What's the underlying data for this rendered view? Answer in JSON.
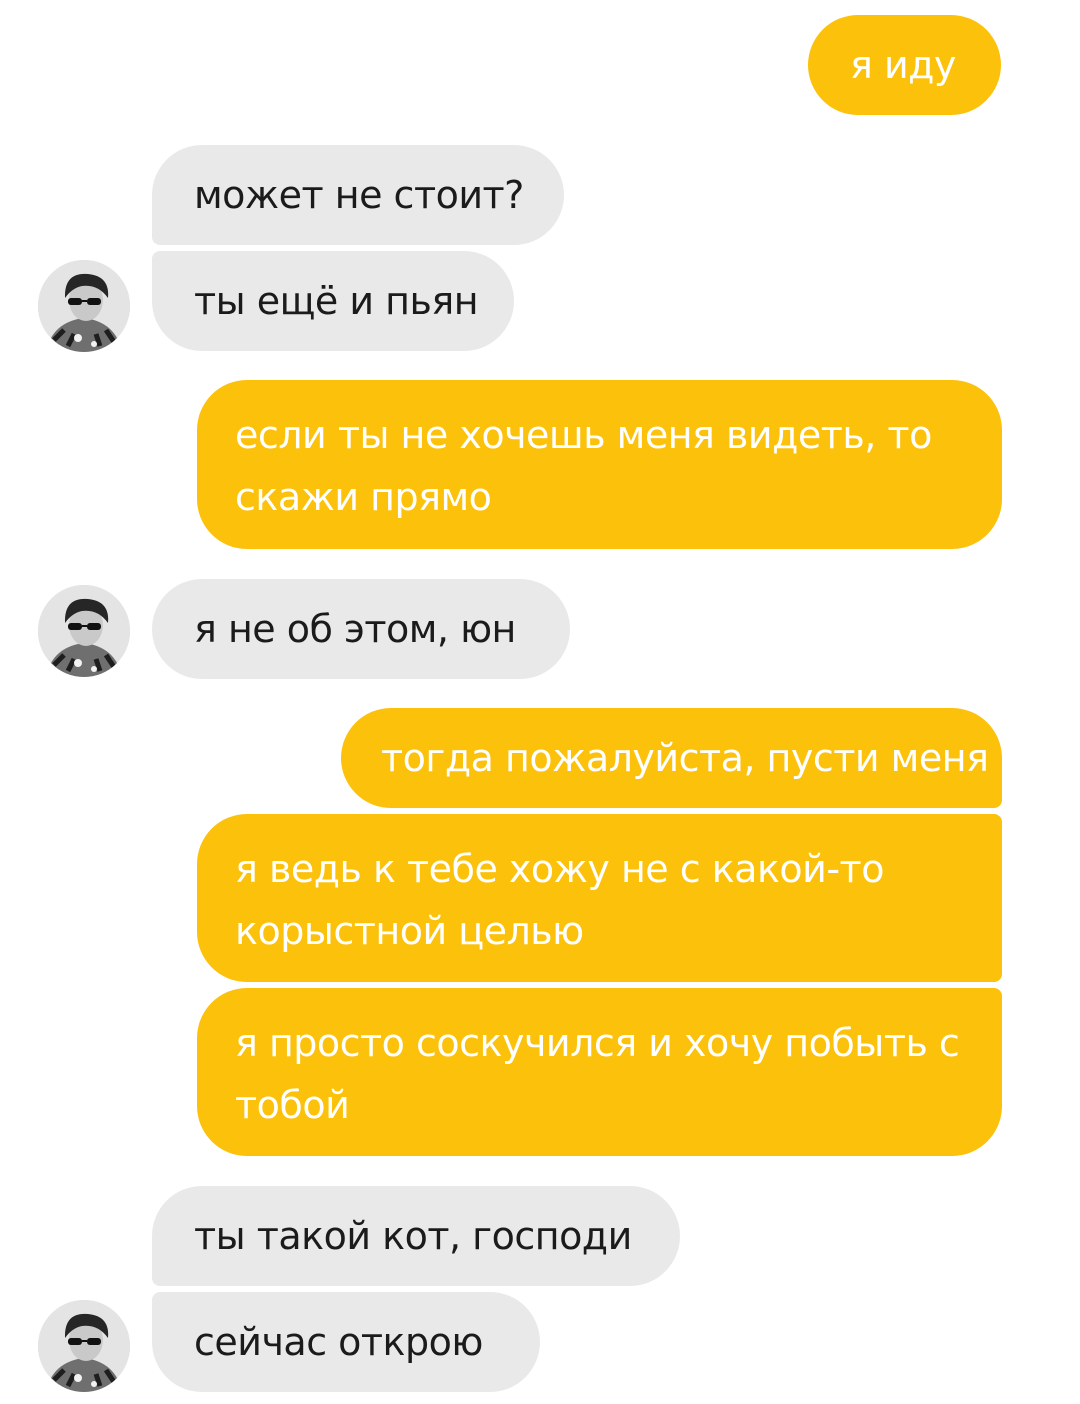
{
  "theme": {
    "outgoing_bubble_color": "#fcc10a",
    "incoming_bubble_color": "#e9e9e9",
    "outgoing_text_color": "#ffffff",
    "incoming_text_color": "#1b1b1b"
  },
  "messages": [
    {
      "sender": "me",
      "text": "я иду"
    },
    {
      "sender": "contact",
      "text": "может не стоит?"
    },
    {
      "sender": "contact",
      "text": "ты ещё и пьян"
    },
    {
      "sender": "me",
      "text": "если ты не хочешь меня видеть, то скажи прямо"
    },
    {
      "sender": "contact",
      "text": "я не об этом, юн"
    },
    {
      "sender": "me",
      "text": "тогда пожалуйста, пусти меня"
    },
    {
      "sender": "me",
      "text": "я ведь к тебе хожу не с какой-то корыстной целью"
    },
    {
      "sender": "me",
      "text": "я просто соскучился и хочу побыть с тобой"
    },
    {
      "sender": "contact",
      "text": "ты такой кот, господи"
    },
    {
      "sender": "contact",
      "text": "сейчас открою"
    }
  ],
  "contact": {
    "avatar_icon": "contact-avatar-photo-icon"
  }
}
